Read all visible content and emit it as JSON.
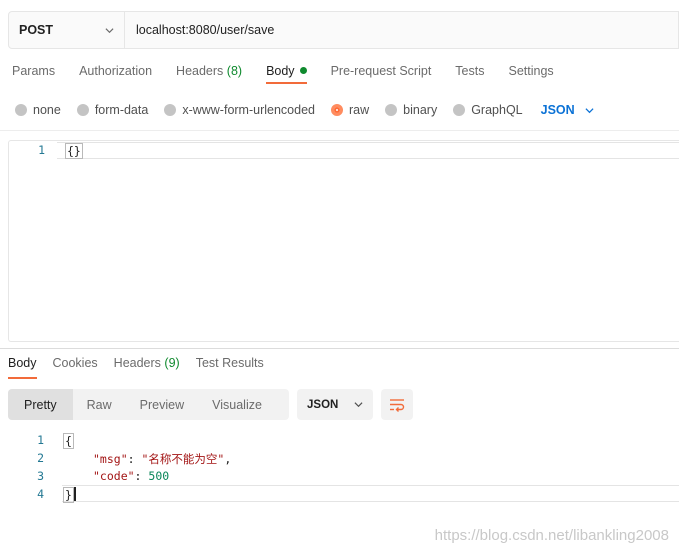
{
  "request": {
    "method": "POST",
    "url": "localhost:8080/user/save"
  },
  "request_tabs": [
    {
      "label": "Params"
    },
    {
      "label": "Authorization"
    },
    {
      "label": "Headers",
      "count": "(8)"
    },
    {
      "label": "Body"
    },
    {
      "label": "Pre-request Script"
    },
    {
      "label": "Tests"
    },
    {
      "label": "Settings"
    }
  ],
  "body_types": [
    "none",
    "form-data",
    "x-www-form-urlencoded",
    "raw",
    "binary",
    "GraphQL"
  ],
  "body_format": "JSON",
  "request_body": {
    "line1_no": "1",
    "line1": "{}"
  },
  "response_tabs": [
    {
      "label": "Body"
    },
    {
      "label": "Cookies"
    },
    {
      "label": "Headers",
      "count": "(9)"
    },
    {
      "label": "Test Results"
    }
  ],
  "view_modes": [
    "Pretty",
    "Raw",
    "Preview",
    "Visualize"
  ],
  "response_format": "JSON",
  "response_body": {
    "line_numbers": [
      "1",
      "2",
      "3",
      "4"
    ],
    "open": "{",
    "msg_key": "\"msg\"",
    "msg_value": "\"名称不能为空\"",
    "code_key": "\"code\"",
    "code_value": "500",
    "close": "}"
  },
  "watermark": "https://blog.csdn.net/libankling2008",
  "colors": {
    "accent": "#f26b3a",
    "link": "#0b72d6",
    "active_dot": "#0f8a2e"
  }
}
